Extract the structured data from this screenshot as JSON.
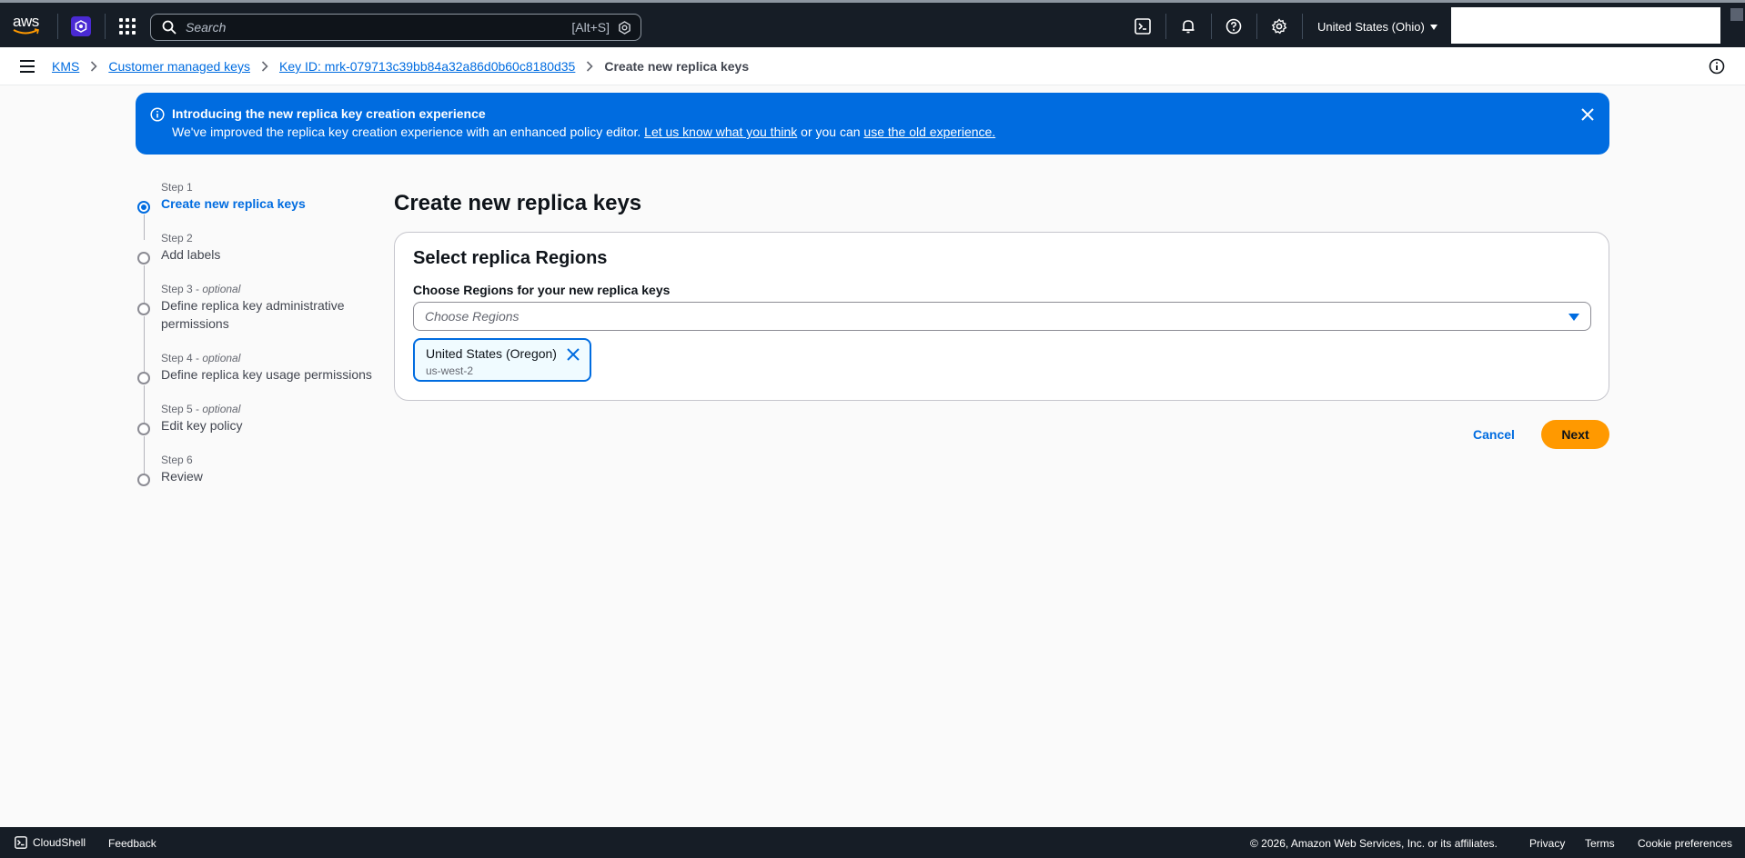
{
  "topnav": {
    "logo_text": "aws",
    "search_placeholder": "Search",
    "search_shortcut": "[Alt+S]",
    "region": "United States (Ohio)"
  },
  "breadcrumb": {
    "items": [
      "KMS",
      "Customer managed keys",
      "Key ID: mrk-079713c39bb84a32a86d0b60c8180d35"
    ],
    "current": "Create new replica keys"
  },
  "flash": {
    "title": "Introducing the new replica key creation experience",
    "body_prefix": "We've improved the replica key creation experience with an enhanced policy editor. ",
    "link1": "Let us know what you think",
    "body_middle": " or you can ",
    "link2": "use the old experience."
  },
  "steps": [
    {
      "num": "Step 1",
      "optional": "",
      "label": "Create new replica keys",
      "active": true
    },
    {
      "num": "Step 2",
      "optional": "",
      "label": "Add labels",
      "active": false
    },
    {
      "num": "Step 3 - ",
      "optional": "optional",
      "label": "Define replica key administrative permissions",
      "active": false
    },
    {
      "num": "Step 4 - ",
      "optional": "optional",
      "label": "Define replica key usage permissions",
      "active": false
    },
    {
      "num": "Step 5 - ",
      "optional": "optional",
      "label": "Edit key policy",
      "active": false
    },
    {
      "num": "Step 6",
      "optional": "",
      "label": "Review",
      "active": false
    }
  ],
  "main": {
    "title": "Create new replica keys",
    "container_title": "Select replica Regions",
    "field_label": "Choose Regions for your new replica keys",
    "select_placeholder": "Choose Regions",
    "token": {
      "name": "United States (Oregon)",
      "code": "us-west-2"
    },
    "cancel_label": "Cancel",
    "next_label": "Next"
  },
  "footer": {
    "cloudshell": "CloudShell",
    "feedback": "Feedback",
    "copyright": "© 2026, Amazon Web Services, Inc. or its affiliates.",
    "privacy": "Privacy",
    "terms": "Terms",
    "cookie": "Cookie preferences"
  },
  "colors": {
    "nav_bg": "#161d26",
    "accent": "#006ce0",
    "primary_button": "#ff9900"
  }
}
